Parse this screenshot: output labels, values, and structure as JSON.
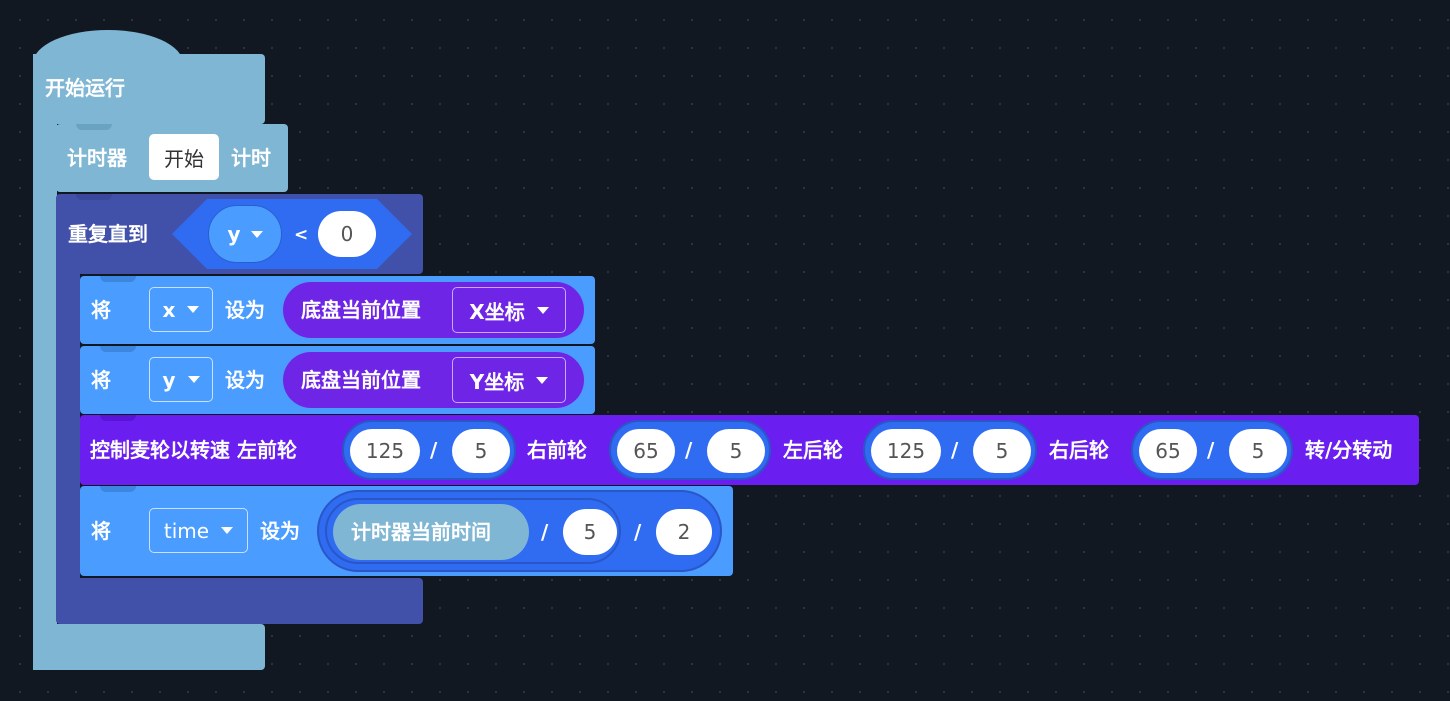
{
  "hat": {
    "label": "开始运行"
  },
  "timer": {
    "prefix": "计时器",
    "action": "开始",
    "suffix": "计时"
  },
  "repeat": {
    "label": "重复直到",
    "condition": {
      "variable": "y",
      "operator": "<",
      "value": "0"
    }
  },
  "set_x": {
    "prefix": "将",
    "variable": "x",
    "middle": "设为",
    "reporter_label": "底盘当前位置",
    "reporter_option": "X坐标"
  },
  "set_y": {
    "prefix": "将",
    "variable": "y",
    "middle": "设为",
    "reporter_label": "底盘当前位置",
    "reporter_option": "Y坐标"
  },
  "motor": {
    "label": "控制麦轮以转速 左前轮",
    "front_left": {
      "a": "125",
      "b": "5"
    },
    "front_right_label": "右前轮",
    "front_right": {
      "a": "65",
      "b": "5"
    },
    "rear_left_label": "左后轮",
    "rear_left": {
      "a": "125",
      "b": "5"
    },
    "rear_right_label": "右后轮",
    "rear_right": {
      "a": "65",
      "b": "5"
    },
    "suffix": "转/分转动",
    "divide": "/"
  },
  "set_time": {
    "prefix": "将",
    "variable": "time",
    "middle": "设为",
    "reporter_label": "计时器当前时间",
    "divisor1": "5",
    "divisor2": "2",
    "divide": "/"
  },
  "colors": {
    "background": "#121821",
    "events": "#7fb6d4",
    "control": "#4150a8",
    "variables": "#4a9cff",
    "operators": "#2f6cf2",
    "chassis": "#6a1ff0"
  }
}
